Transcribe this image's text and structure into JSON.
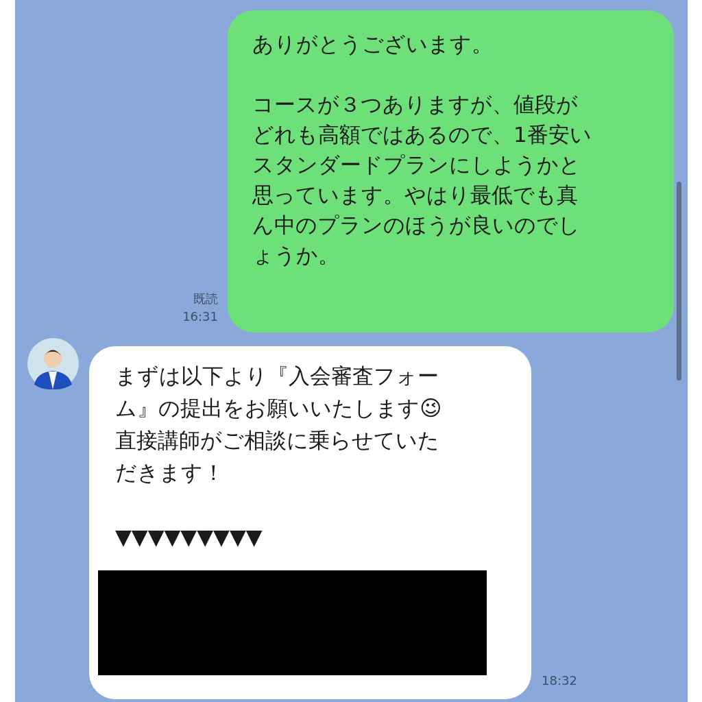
{
  "messages": [
    {
      "kind": "sent",
      "lines": [
        {
          "kind": "text",
          "text": "ありがとうございます。"
        },
        {
          "kind": "blank"
        },
        {
          "kind": "text",
          "text": "コースが３つありますが、値段が"
        },
        {
          "kind": "text",
          "text": "どれも高額ではあるので、1番安い"
        },
        {
          "kind": "text",
          "text": "スタンダードプランにしようかと"
        },
        {
          "kind": "text",
          "text": "思っています。やはり最低でも真"
        },
        {
          "kind": "text",
          "text": "ん中のプランのほうが良いのでし"
        },
        {
          "kind": "text",
          "text": "ょうか。"
        }
      ],
      "read": "既読",
      "time": "16:31"
    },
    {
      "kind": "received",
      "lines": [
        {
          "kind": "text",
          "text": "まずは以下より『入会審査フォー"
        },
        {
          "kind": "text",
          "text": "ム』の提出をお願いいたします😉"
        },
        {
          "kind": "text",
          "text": "直接講師がご相談に乗らせていた"
        },
        {
          "kind": "text",
          "text": "だきます！"
        },
        {
          "kind": "blank"
        },
        {
          "kind": "text",
          "text": "▼▼▼▼▼▼▼▼▼"
        }
      ],
      "redacted": true,
      "time": "18:32"
    }
  ]
}
